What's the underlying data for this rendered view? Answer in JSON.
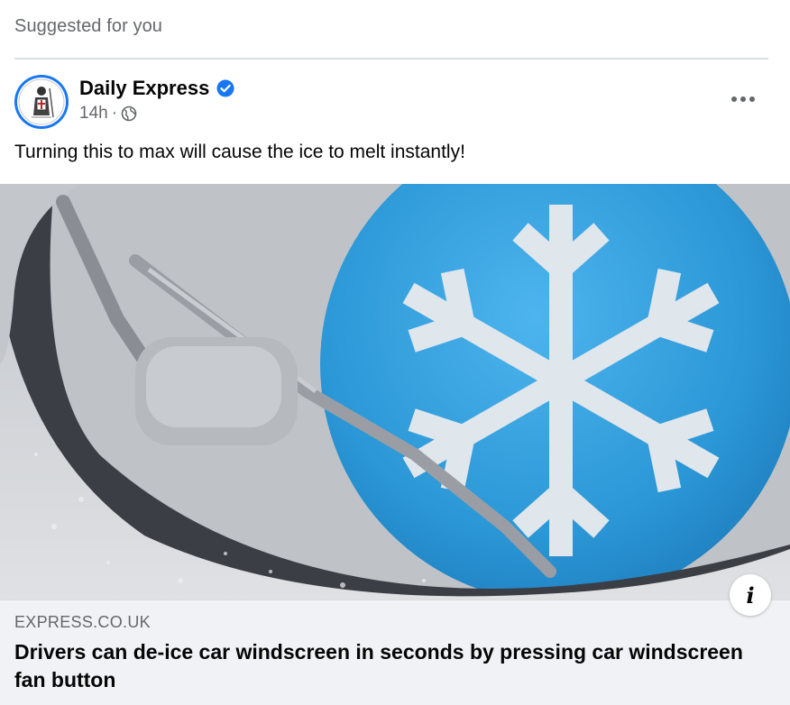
{
  "header": {
    "suggested_label": "Suggested for you"
  },
  "post": {
    "page_name": "Daily Express",
    "verified": true,
    "time": "14h",
    "separator": "·",
    "audience_icon": "globe-icon",
    "more_icon": "ellipsis-icon",
    "text": "Turning this to max will cause the ice to melt instantly!"
  },
  "link": {
    "domain": "EXPRESS.CO.UK",
    "headline": "Drivers can de-ice car windscreen in seconds by pressing car windscreen fan button",
    "info_label": "i"
  },
  "colors": {
    "accent": "#1877f2",
    "secondary_text": "#65676b",
    "link_bg": "#f0f2f5",
    "snowflake_circle": "#3aa0d8"
  }
}
